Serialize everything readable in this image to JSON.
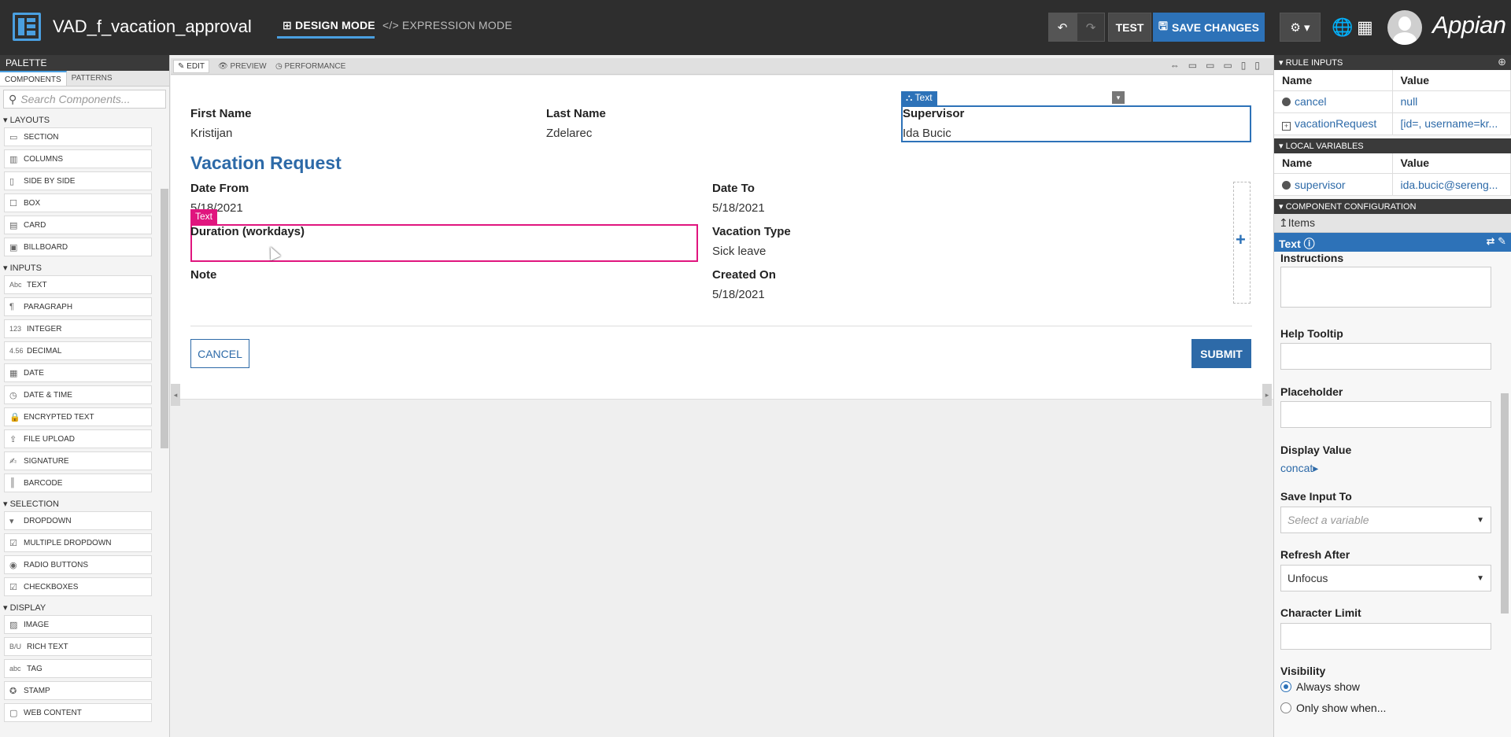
{
  "header": {
    "app_title": "VAD_f_vacation_approval",
    "design_mode": "DESIGN MODE",
    "expression_mode": "EXPRESSION MODE",
    "test_label": "TEST",
    "save_label": "SAVE CHANGES",
    "brand": "Appian"
  },
  "palette": {
    "title": "PALETTE",
    "tabs": [
      "COMPONENTS",
      "PATTERNS"
    ],
    "search_placeholder": "Search Components...",
    "sections": [
      {
        "name": "LAYOUTS",
        "items": [
          {
            "icon": "▭",
            "label": "SECTION"
          },
          {
            "icon": "▥",
            "label": "COLUMNS"
          },
          {
            "icon": "▯",
            "label": "SIDE BY SIDE"
          },
          {
            "icon": "☐",
            "label": "BOX"
          },
          {
            "icon": "▤",
            "label": "CARD"
          },
          {
            "icon": "▣",
            "label": "BILLBOARD"
          }
        ]
      },
      {
        "name": "INPUTS",
        "items": [
          {
            "icon": "Abc",
            "label": "TEXT"
          },
          {
            "icon": "¶",
            "label": "PARAGRAPH"
          },
          {
            "icon": "123",
            "label": "INTEGER"
          },
          {
            "icon": "4.56",
            "label": "DECIMAL"
          },
          {
            "icon": "▦",
            "label": "DATE"
          },
          {
            "icon": "◷",
            "label": "DATE & TIME"
          },
          {
            "icon": "🔒",
            "label": "ENCRYPTED TEXT"
          },
          {
            "icon": "⇪",
            "label": "FILE UPLOAD"
          },
          {
            "icon": "✍",
            "label": "SIGNATURE"
          },
          {
            "icon": "║",
            "label": "BARCODE"
          }
        ]
      },
      {
        "name": "SELECTION",
        "items": [
          {
            "icon": "▾",
            "label": "DROPDOWN"
          },
          {
            "icon": "☑",
            "label": "MULTIPLE DROPDOWN"
          },
          {
            "icon": "◉",
            "label": "RADIO BUTTONS"
          },
          {
            "icon": "☑",
            "label": "CHECKBOXES"
          }
        ]
      },
      {
        "name": "DISPLAY",
        "items": [
          {
            "icon": "▨",
            "label": "IMAGE"
          },
          {
            "icon": "B/U",
            "label": "RICH TEXT"
          },
          {
            "icon": "abc",
            "label": "TAG"
          },
          {
            "icon": "✪",
            "label": "STAMP"
          },
          {
            "icon": "▢",
            "label": "WEB CONTENT"
          }
        ]
      }
    ]
  },
  "center": {
    "tabs": [
      "EDIT",
      "PREVIEW",
      "PERFORMANCE"
    ],
    "fields": {
      "first_name_label": "First Name",
      "first_name": "Kristijan",
      "last_name_label": "Last Name",
      "last_name": "Zdelarec",
      "supervisor_label": "Supervisor",
      "supervisor": "Ida Bucic",
      "section_title": "Vacation Request",
      "date_from_label": "Date From",
      "date_from": "5/18/2021",
      "date_to_label": "Date To",
      "date_to": "5/18/2021",
      "duration_label": "Duration (workdays)",
      "vacation_type_label": "Vacation Type",
      "vacation_type": "Sick leave",
      "note_label": "Note",
      "created_on_label": "Created On",
      "created_on": "5/18/2021"
    },
    "selected_tag": "Text",
    "hover_tag": "Text",
    "cancel_label": "CANCEL",
    "submit_label": "SUBMIT"
  },
  "right_panel": {
    "rule_inputs_title": "RULE INPUTS",
    "col_name": "Name",
    "col_value": "Value",
    "rule_inputs": [
      {
        "name": "cancel",
        "value": "null"
      },
      {
        "name": "vacationRequest",
        "value": "[id=, username=kr..."
      }
    ],
    "local_variables_title": "LOCAL VARIABLES",
    "local_variables": [
      {
        "name": "supervisor",
        "value": "ida.bucic@sereng..."
      }
    ],
    "component_config_title": "COMPONENT CONFIGURATION",
    "items_label": "Items",
    "component_name": "Text",
    "instructions_label": "Instructions",
    "help_tooltip_label": "Help Tooltip",
    "placeholder_label": "Placeholder",
    "display_value_label": "Display Value",
    "display_value_link": "concat",
    "save_input_label": "Save Input To",
    "save_input_placeholder": "Select a variable",
    "refresh_after_label": "Refresh After",
    "refresh_after_value": "Unfocus",
    "char_limit_label": "Character Limit",
    "visibility_label": "Visibility",
    "visibility_opt1": "Always show",
    "visibility_opt2": "Only show when..."
  }
}
